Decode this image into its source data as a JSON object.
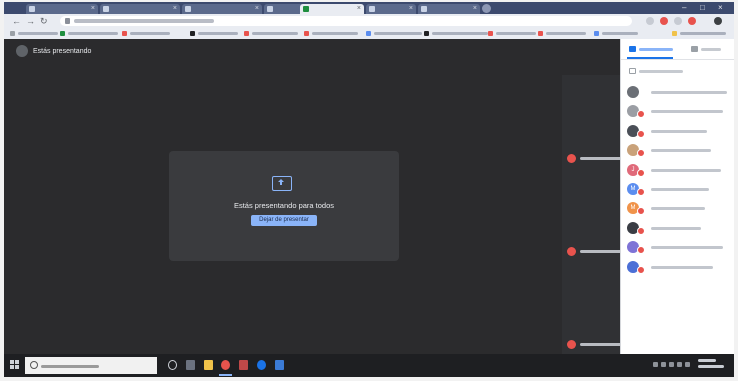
{
  "colors": {
    "meet_background": "#2b2b2d",
    "accent_blue": "#8ab4f8",
    "participant_badge": "#e8534d",
    "taskbar": "#1e1f22",
    "tab_strip": "#3c4a6e"
  },
  "browser": {
    "tab_count": 7,
    "active_tab_index": 3,
    "tab_close_glyph": "×",
    "icons": [
      "back-icon",
      "forward-icon",
      "reload-icon",
      "lock-icon",
      "profile-icon"
    ]
  },
  "meet": {
    "presenting_banner": "Estás presentando",
    "share_card_title": "Estás presentando para todos",
    "share_icon": "present-screen-icon",
    "stop_button": "Dejar de presentar"
  },
  "participants_panel": {
    "tab_people_icon": "people-icon",
    "tab_chat_icon": "chat-icon",
    "add_people_icon": "person-add-icon",
    "rows": [
      {
        "avatar_color": "#6b6f76",
        "initial": "",
        "muted": false
      },
      {
        "avatar_color": "#9b9ea4",
        "initial": "",
        "muted": true
      },
      {
        "avatar_color": "#4a4f57",
        "initial": "",
        "muted": true
      },
      {
        "avatar_color": "#c9a27a",
        "initial": "",
        "muted": true
      },
      {
        "avatar_color": "#e06a7a",
        "initial": "J",
        "muted": true
      },
      {
        "avatar_color": "#5b8def",
        "initial": "M",
        "muted": true
      },
      {
        "avatar_color": "#f0934a",
        "initial": "M",
        "muted": true
      },
      {
        "avatar_color": "#3a3d44",
        "initial": "",
        "muted": true
      },
      {
        "avatar_color": "#7e73d6",
        "initial": "",
        "muted": true
      },
      {
        "avatar_color": "#4c6fd6",
        "initial": "",
        "muted": true
      }
    ]
  },
  "video_strip": {
    "tile_count": 3
  },
  "taskbar": {
    "icons": [
      "windows-start-icon",
      "search-icon",
      "task-view-icon",
      "file-explorer-icon",
      "chrome-icon",
      "edge-icon",
      "mail-icon",
      "word-icon",
      "teams-icon"
    ]
  }
}
